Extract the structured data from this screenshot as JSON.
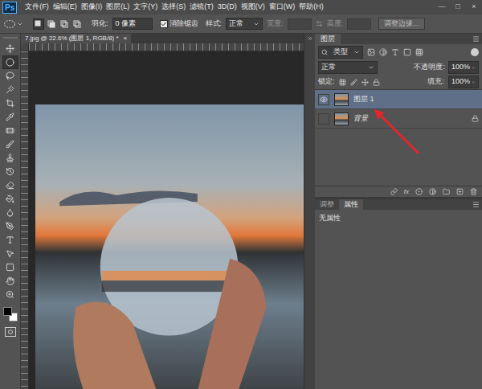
{
  "app": {
    "logo": "Ps"
  },
  "menu": [
    "文件(F)",
    "编辑(E)",
    "图像(I)",
    "图层(L)",
    "文字(Y)",
    "选择(S)",
    "滤镜(T)",
    "3D(D)",
    "视图(V)",
    "窗口(W)",
    "帮助(H)"
  ],
  "window_controls": [
    "—",
    "□",
    "×"
  ],
  "options_bar": {
    "selection_modes": [
      {
        "selected": true
      },
      {
        "selected": false
      },
      {
        "selected": false
      },
      {
        "selected": false
      }
    ],
    "feather_label": "羽化:",
    "feather_value": "0 像素",
    "antialias": {
      "label": "消除锯齿",
      "checked": true
    },
    "style_label": "样式:",
    "style_value": "正常",
    "width_label": "宽度:",
    "height_label": "高度:",
    "refine_button": "调整边缘..."
  },
  "tools": [
    {
      "selected": false
    },
    {
      "selected": true
    },
    {
      "selected": false
    },
    {
      "selected": false
    },
    {
      "selected": false
    },
    {
      "selected": false
    },
    {
      "selected": false
    },
    {
      "selected": false
    },
    {
      "selected": false
    },
    {
      "selected": false
    },
    {
      "selected": false
    },
    {
      "selected": false
    },
    {
      "selected": false
    },
    {
      "selected": false
    },
    {
      "selected": false
    },
    {
      "selected": false
    },
    {
      "selected": false
    },
    {
      "selected": false
    },
    {
      "selected": false
    }
  ],
  "document": {
    "tab": "7.jpg @ 22.6% (图层 1, RGB/8) *",
    "close": "×"
  },
  "layers_panel": {
    "tab": "图层",
    "filter": "类型",
    "blend_mode": "正常",
    "opacity_label": "不透明度:",
    "opacity": "100%",
    "lock_label": "锁定:",
    "fill_label": "填充:",
    "fill": "100%",
    "fx": "fx",
    "layers": [
      {
        "name": "图层 1",
        "selected": true,
        "visible": true,
        "locked": false
      },
      {
        "name": "背景",
        "selected": false,
        "visible": false,
        "locked": true
      }
    ]
  },
  "properties_panel": {
    "tabs": [
      {
        "label": "调整",
        "selected": false
      },
      {
        "label": "属性",
        "selected": true
      }
    ],
    "message": "无属性"
  }
}
